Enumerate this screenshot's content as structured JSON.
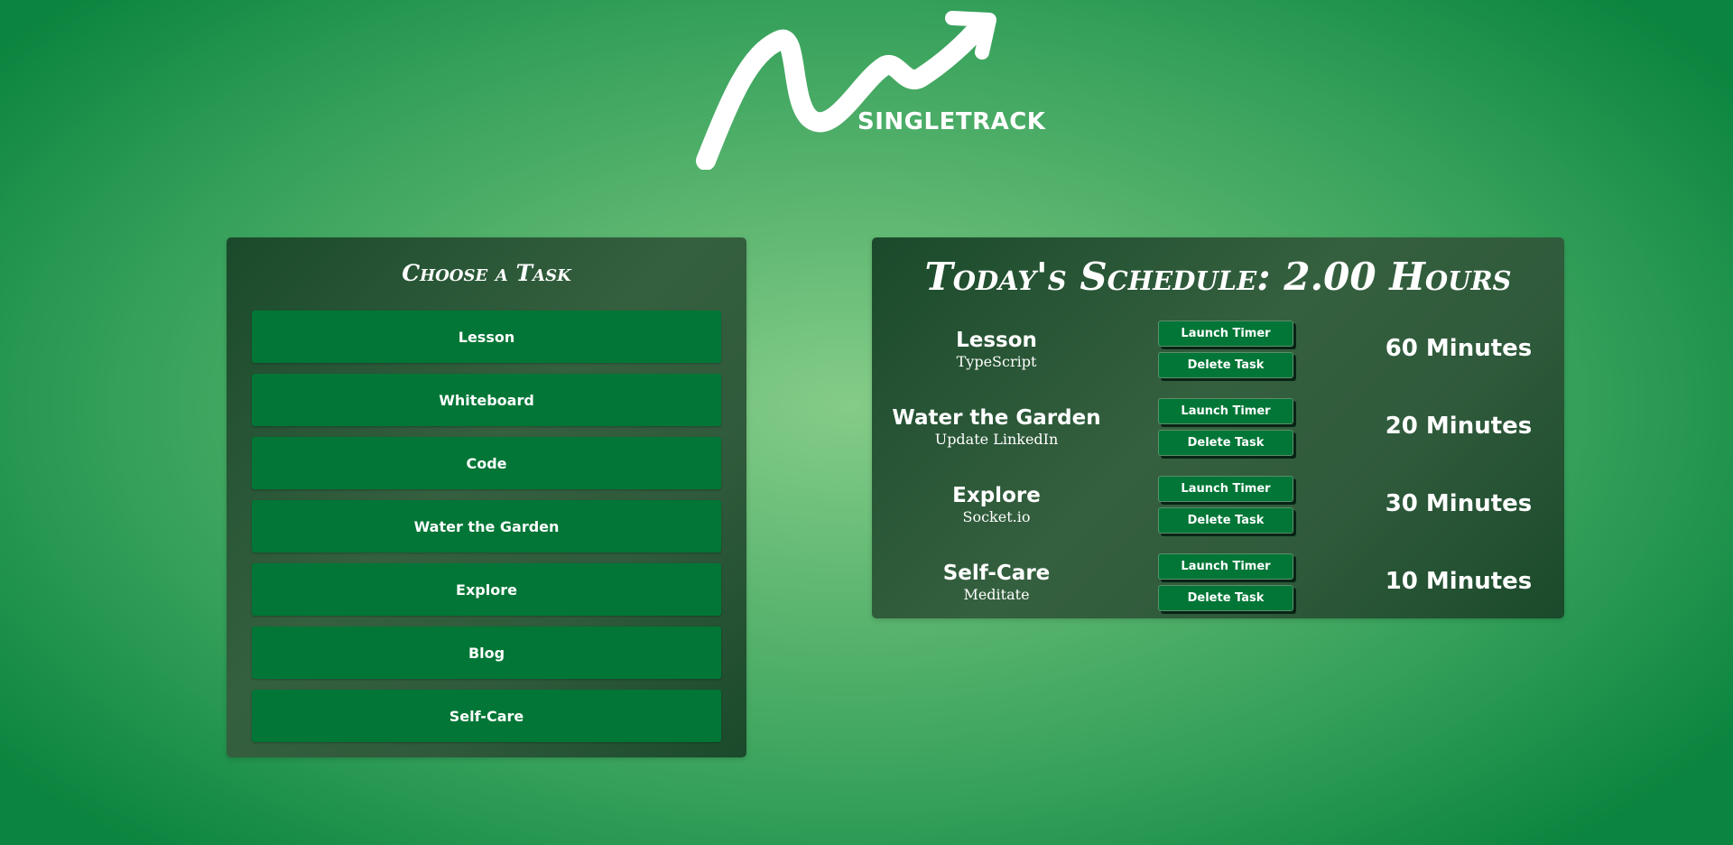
{
  "brand": {
    "name": "SINGLETRACK"
  },
  "task_panel": {
    "title": "Choose a Task",
    "tasks": [
      "Lesson",
      "Whiteboard",
      "Code",
      "Water the Garden",
      "Explore",
      "Blog",
      "Self-Care"
    ]
  },
  "schedule": {
    "title": "Today's Schedule: 2.00 Hours",
    "launch_label": "Launch Timer",
    "delete_label": "Delete Task",
    "items": [
      {
        "name": "Lesson",
        "detail": "TypeScript",
        "duration": "60 Minutes"
      },
      {
        "name": "Water the Garden",
        "detail": "Update LinkedIn",
        "duration": "20 Minutes"
      },
      {
        "name": "Explore",
        "detail": "Socket.io",
        "duration": "30 Minutes"
      },
      {
        "name": "Self-Care",
        "detail": "Meditate",
        "duration": "10 Minutes"
      }
    ]
  },
  "colors": {
    "button_green": "#017636",
    "panel_dark": "#1a4a2b",
    "background_light": "#84cc88",
    "background_dark": "#0b843f"
  },
  "icons": {
    "logo": "scribble-arrow-icon"
  }
}
